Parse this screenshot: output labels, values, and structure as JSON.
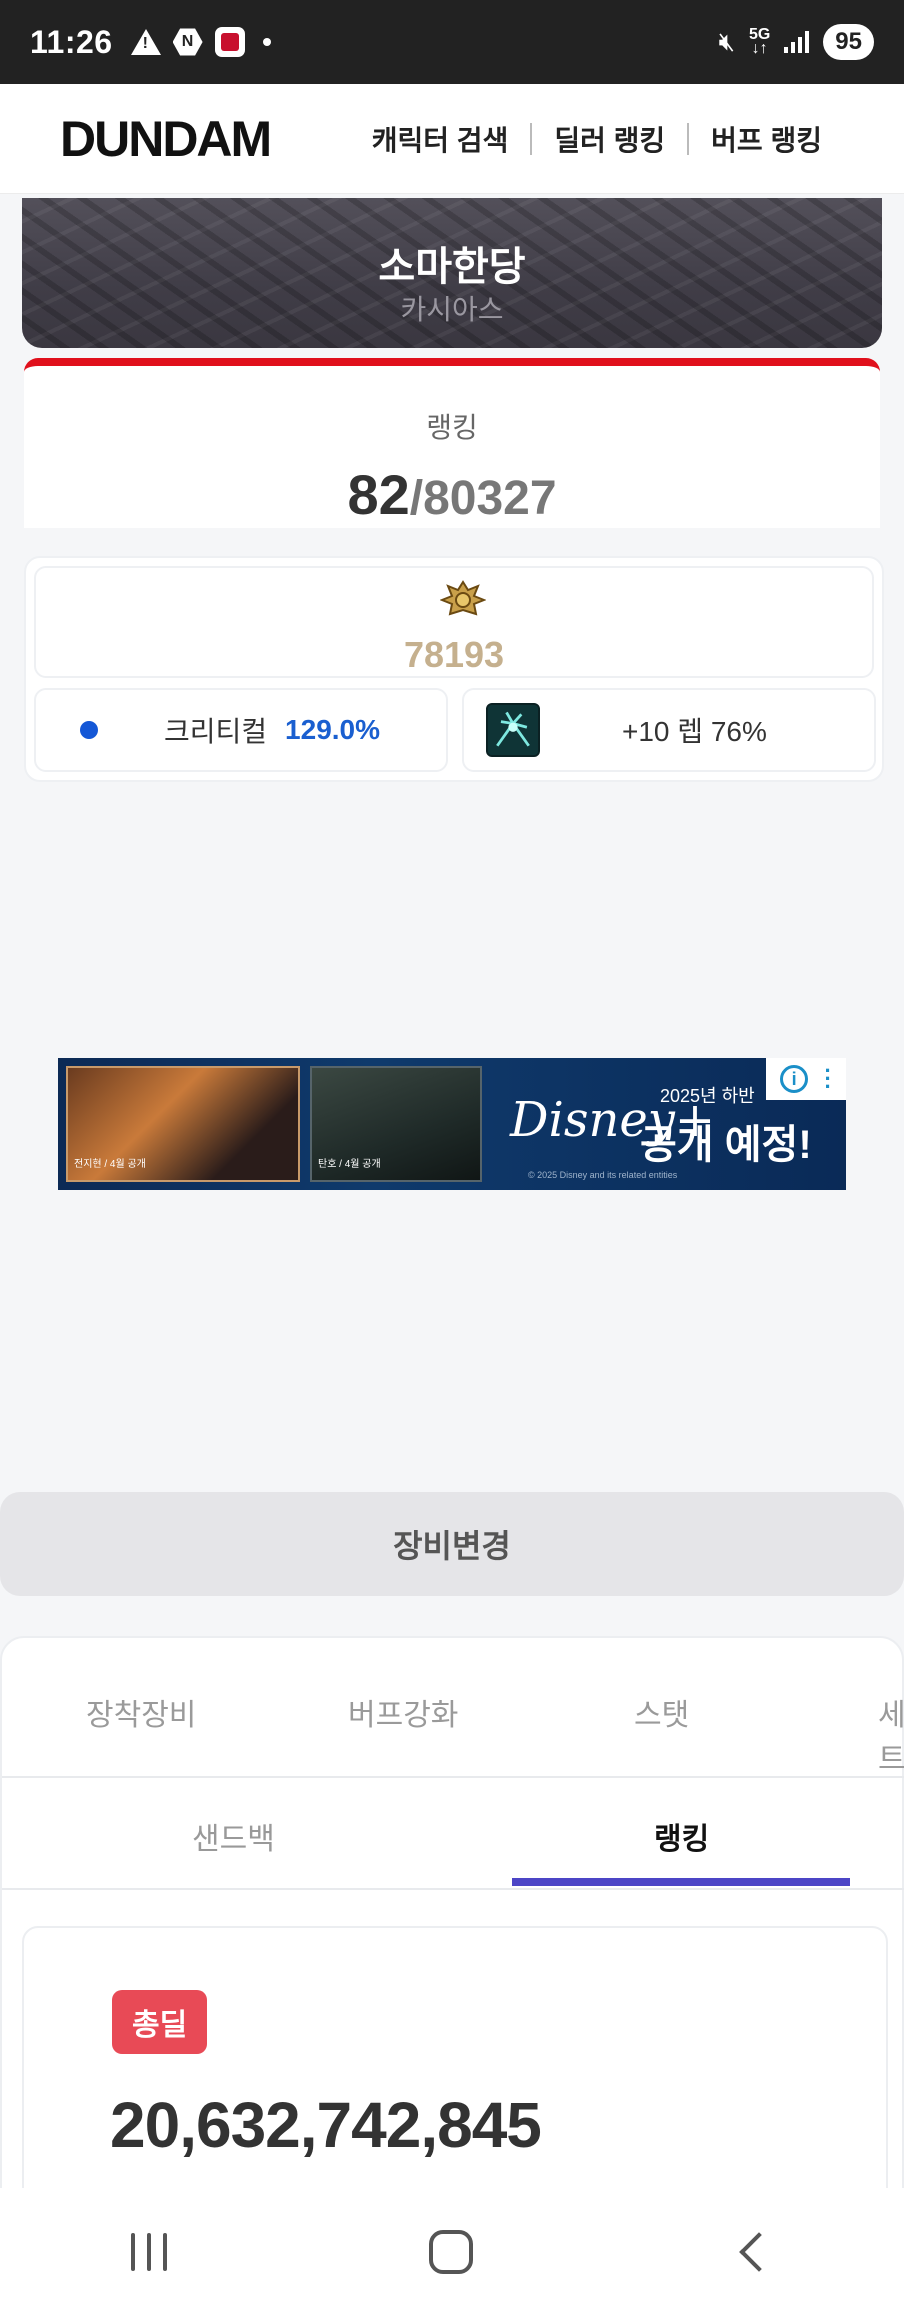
{
  "status_bar": {
    "time": "11:26",
    "left_icons": [
      "warning-icon",
      "n-icon",
      "app-icon",
      "dot-icon"
    ],
    "right_icons": [
      "mute-icon",
      "5g-icon",
      "signal-icon"
    ],
    "network": "5G",
    "battery": "95"
  },
  "nav": {
    "logo": "DUNDAM",
    "links": [
      "캐릭터 검색",
      "딜러 랭킹",
      "버프 랭킹"
    ]
  },
  "character": {
    "name": "소마한당",
    "server": "카시아스"
  },
  "ranking": {
    "label": "랭킹",
    "rank": "82",
    "total": "/80327"
  },
  "fame": {
    "emblem_icon": "fame-emblem-icon",
    "value": "78193",
    "crit_label": "크리티컬",
    "crit_value": "129.0%",
    "skill_icon": "skill-icon",
    "skill_text": "+10 렙 76%"
  },
  "ad": {
    "logo": "Disney+",
    "tag": "2025년 하반",
    "headline": "공개 예정!",
    "legal": "© 2025 Disney and its related entities",
    "caption1": "전지현 / 4월 공개",
    "caption2": "탄호 / 4월 공개",
    "info_icon": "info-icon"
  },
  "equip_button": "장비변경",
  "tabs_row1": [
    "장착장비",
    "버프강화",
    "스탯",
    "세트"
  ],
  "tabs_row2": [
    "샌드백",
    "랭킹"
  ],
  "active_tab2": "랭킹",
  "damage": {
    "badge": "총딜",
    "value": "20,632,742,845"
  },
  "colors": {
    "accent_red": "#e0101c",
    "fame_gold": "#c5b08e",
    "crit_blue": "#1a5fd0",
    "tab_underline": "#4c45c6",
    "badge_red": "#e84a56"
  }
}
